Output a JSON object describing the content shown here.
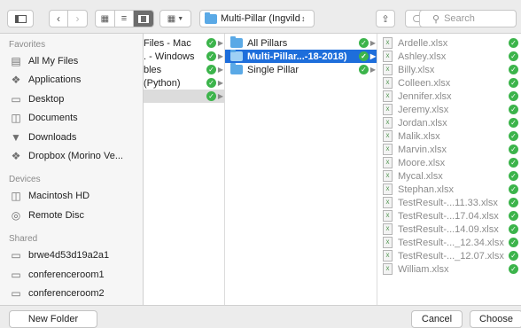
{
  "toolbar": {
    "path_label": "Multi-Pillar (Ingvild Test…",
    "search_placeholder": "Search"
  },
  "sidebar": {
    "favorites_header": "Favorites",
    "favorites": [
      {
        "label": "All My Files",
        "icon": "all-files-icon"
      },
      {
        "label": "Applications",
        "icon": "applications-icon"
      },
      {
        "label": "Desktop",
        "icon": "desktop-icon"
      },
      {
        "label": "Documents",
        "icon": "documents-icon"
      },
      {
        "label": "Downloads",
        "icon": "downloads-icon"
      },
      {
        "label": "Dropbox (Morino Ve...",
        "icon": "dropbox-icon"
      }
    ],
    "devices_header": "Devices",
    "devices": [
      {
        "label": "Macintosh HD",
        "icon": "hard-disk-icon"
      },
      {
        "label": "Remote Disc",
        "icon": "disc-icon"
      }
    ],
    "shared_header": "Shared",
    "shared": [
      {
        "label": "brwe4d53d19a2a1",
        "icon": "computer-icon"
      },
      {
        "label": "conferenceroom1",
        "icon": "computer-icon"
      },
      {
        "label": "conferenceroom2",
        "icon": "computer-icon"
      }
    ]
  },
  "column1": {
    "items": [
      {
        "label": "Files - Mac"
      },
      {
        "label": ". - Windows"
      },
      {
        "label": "bles"
      },
      {
        "label": " (Python)"
      },
      {
        "label": ""
      }
    ]
  },
  "column2": {
    "items": [
      {
        "label": "All Pillars"
      },
      {
        "label": "Multi-Pillar...-18-2018)"
      },
      {
        "label": "Single Pillar"
      }
    ]
  },
  "column3": {
    "items": [
      {
        "label": "Ardelle.xlsx"
      },
      {
        "label": "Ashley.xlsx"
      },
      {
        "label": "Billy.xlsx"
      },
      {
        "label": "Colleen.xlsx"
      },
      {
        "label": "Jennifer.xlsx"
      },
      {
        "label": "Jeremy.xlsx"
      },
      {
        "label": "Jordan.xlsx"
      },
      {
        "label": "Malik.xlsx"
      },
      {
        "label": "Marvin.xlsx"
      },
      {
        "label": "Moore.xlsx"
      },
      {
        "label": "Mycal.xlsx"
      },
      {
        "label": "Stephan.xlsx"
      },
      {
        "label": "TestResult-...11.33.xlsx"
      },
      {
        "label": "TestResult-...17.04.xlsx"
      },
      {
        "label": "TestResult-...14.09.xlsx"
      },
      {
        "label": "TestResult-..._12.34.xlsx"
      },
      {
        "label": "TestResult-..._12.07.xlsx"
      },
      {
        "label": "William.xlsx"
      }
    ]
  },
  "bottom": {
    "new_folder_label": "New Folder",
    "cancel_label": "Cancel",
    "choose_label": "Choose"
  },
  "colors": {
    "selection_blue": "#1e6edb",
    "selection_gray": "#dcdcdc",
    "sync_green": "#3cb44b",
    "folder_blue": "#5aa9e6"
  }
}
